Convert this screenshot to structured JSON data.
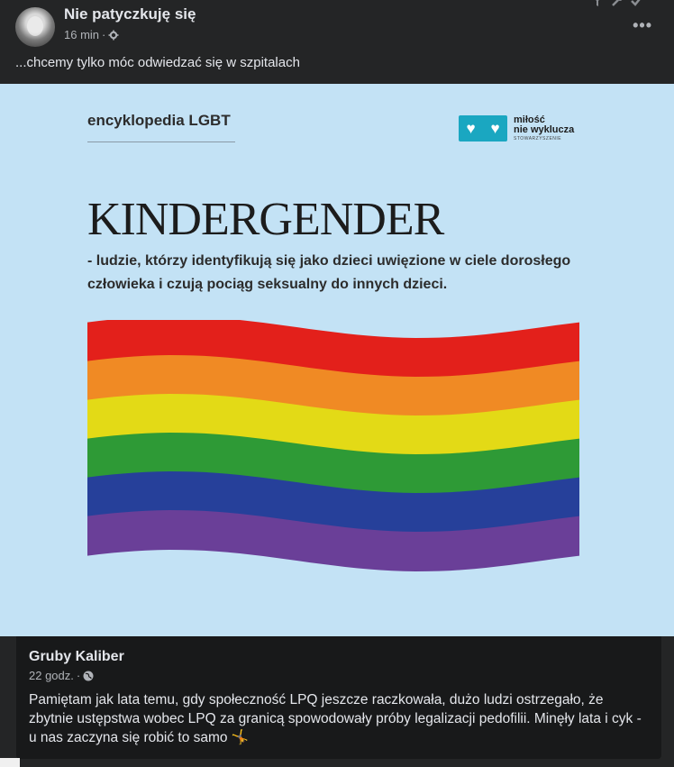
{
  "post": {
    "page_name": "Nie patyczkuję się",
    "time": "16 min",
    "separator": "·",
    "more": "•••",
    "caption": "...chcemy tylko móc odwiedzać się w szpitalach"
  },
  "image": {
    "series_label": "encyklopedia LGBT",
    "logo": {
      "line1": "miłość",
      "line2": "nie wyklucza",
      "line3": "STOWARZYSZENIE",
      "icon": "heart-icon"
    },
    "headline": "KINDERGENDER",
    "definition": "- ludzie, którzy identyfikują się jako dzieci uwięzione w ciele dorosłego człowieka i czują pociąg seksualny do innych dzieci.",
    "flag_colors": [
      "#e3201b",
      "#f08a24",
      "#e3da16",
      "#2e9a36",
      "#26409a",
      "#6a3f98"
    ]
  },
  "comment": {
    "author": "Gruby Kaliber",
    "time": "22 godz.",
    "separator": "·",
    "text": "Pamiętam jak lata temu, gdy społeczność LPQ jeszcze raczkowała, dużo ludzi ostrzegało, że zbytnie ustępstwa wobec LPQ za granicą spowodowały próby legalizacji pedofilii. Minęły lata i cyk - u nas zaczyna się robić to samo 🤸"
  },
  "colors": {
    "background": "#242526",
    "comment_bg": "#18191a",
    "image_bg": "#c3e2f5",
    "logo_accent": "#1aa7c1"
  }
}
